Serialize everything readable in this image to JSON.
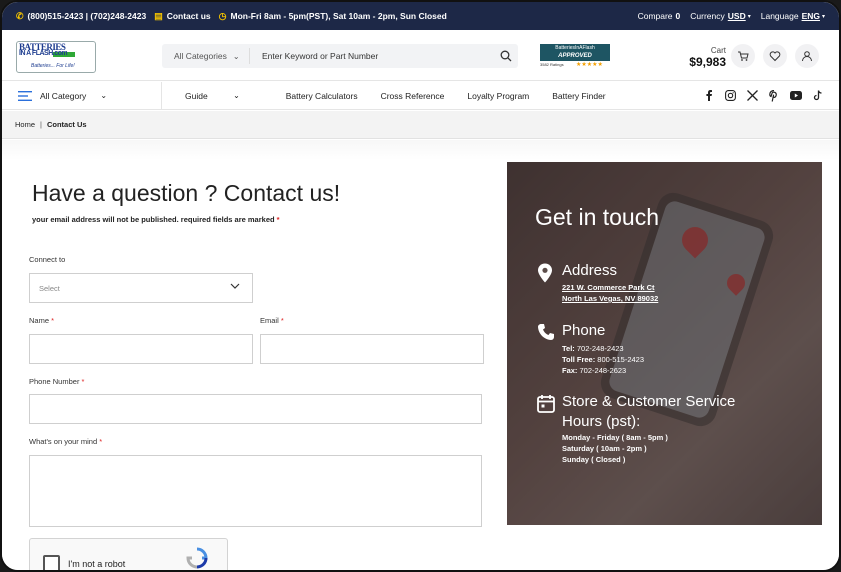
{
  "topbar": {
    "phones": "(800)515-2423 | (702)248-2423",
    "contact": "Contact us",
    "hours": "Mon-Fri 8am - 5pm(PST), Sat 10am - 2pm, Sun Closed",
    "compare_label": "Compare",
    "compare_count": "0",
    "currency_label": "Currency",
    "currency_value": "USD",
    "language_label": "Language",
    "language_value": "ENG"
  },
  "header": {
    "logo_line1": "BATTERIES",
    "logo_line2": "IN A FLASH.com",
    "logo_tagline": "Batteries... For Life!",
    "search_category": "All Categories",
    "search_placeholder": "Enter Keyword or Part Number",
    "badge_top": "BatteriesInAFlash",
    "badge_main": "APPROVED",
    "badge_bottom": "3582 Ratings",
    "cart_label": "Cart",
    "cart_amount": "$9,983"
  },
  "nav": {
    "all_category": "All Category",
    "links": [
      "Guide",
      "Battery Calculators",
      "Cross Reference",
      "Loyalty Program",
      "Battery Finder"
    ]
  },
  "breadcrumb": {
    "home": "Home",
    "current": "Contact Us"
  },
  "form": {
    "title": "Have a question ? Contact us!",
    "subtitle": "your email address will not be published. required fields are marked",
    "required_mark": "*",
    "connect_label": "Connect to",
    "connect_placeholder": "Select",
    "name_label": "Name",
    "email_label": "Email",
    "phone_label": "Phone Number",
    "message_label": "What's on your mind",
    "captcha_text": "I'm not a robot"
  },
  "contact_card": {
    "heading": "Get in touch",
    "address_title": "Address",
    "address_line1": "221 W. Commerce Park Ct",
    "address_line2": "North Las Vegas, NV 89032",
    "phone_title": "Phone",
    "tel_label": "Tel:",
    "tel_value": "702-248-2423",
    "tollfree_label": "Toll Free:",
    "tollfree_value": "800-515-2423",
    "fax_label": "Fax:",
    "fax_value": "702-248-2623",
    "hours_title_1": "Store & Customer Service",
    "hours_title_2": "Hours (pst):",
    "hours_1": "Monday - Friday ( 8am - 5pm )",
    "hours_2": "Saturday ( 10am - 2pm )",
    "hours_3": "Sunday ( Closed )"
  },
  "colors": {
    "topbar": "#1d2847",
    "accent": "#f2c200",
    "required": "#dd2222"
  }
}
